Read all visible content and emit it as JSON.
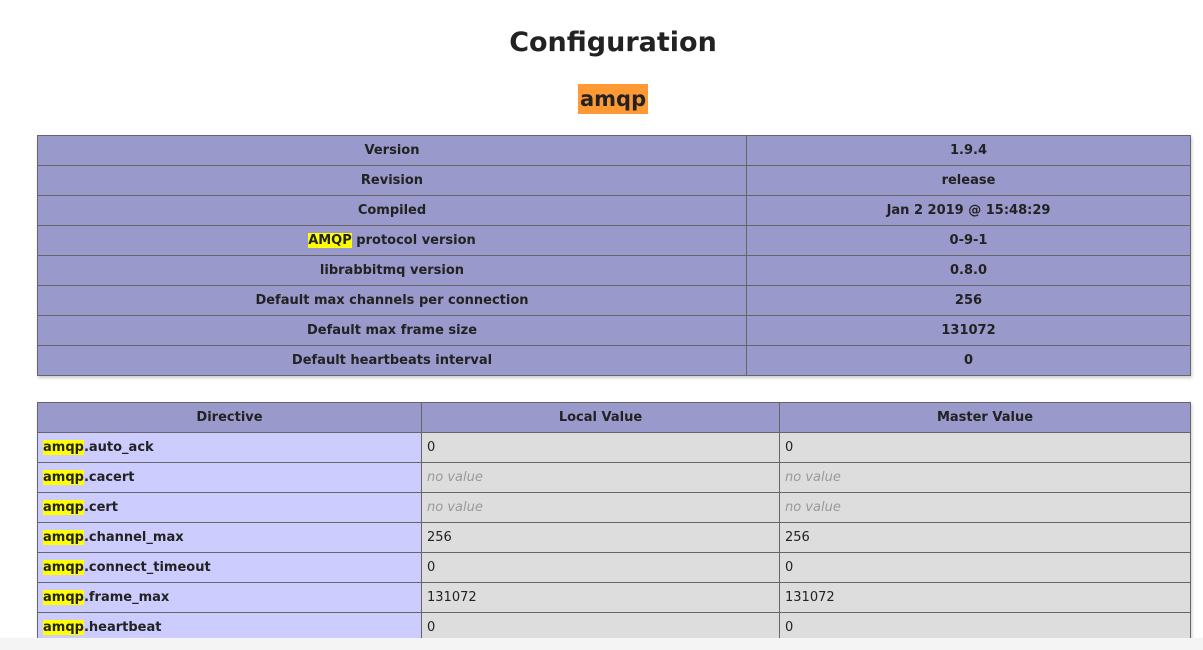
{
  "page": {
    "title": "Configuration",
    "extension": "amqp",
    "highlight_term": "amqp"
  },
  "info": {
    "rows": [
      {
        "label_pre": "",
        "label_hl": "",
        "label_post": "Version",
        "value": "1.9.4"
      },
      {
        "label_pre": "",
        "label_hl": "",
        "label_post": "Revision",
        "value": "release"
      },
      {
        "label_pre": "",
        "label_hl": "",
        "label_post": "Compiled",
        "value": "Jan 2 2019 @ 15:48:29"
      },
      {
        "label_pre": "",
        "label_hl": "AMQP",
        "label_post": " protocol version",
        "value": "0-9-1"
      },
      {
        "label_pre": "",
        "label_hl": "",
        "label_post": "librabbitmq version",
        "value": "0.8.0"
      },
      {
        "label_pre": "",
        "label_hl": "",
        "label_post": "Default max channels per connection",
        "value": "256"
      },
      {
        "label_pre": "",
        "label_hl": "",
        "label_post": "Default max frame size",
        "value": "131072"
      },
      {
        "label_pre": "",
        "label_hl": "",
        "label_post": "Default heartbeats interval",
        "value": "0"
      }
    ]
  },
  "directives": {
    "headers": {
      "directive": "Directive",
      "local": "Local Value",
      "master": "Master Value"
    },
    "rows": [
      {
        "prefix": "amqp",
        "name": ".auto_ack",
        "local": "0",
        "master": "0",
        "no_value": false
      },
      {
        "prefix": "amqp",
        "name": ".cacert",
        "local": "no value",
        "master": "no value",
        "no_value": true
      },
      {
        "prefix": "amqp",
        "name": ".cert",
        "local": "no value",
        "master": "no value",
        "no_value": true
      },
      {
        "prefix": "amqp",
        "name": ".channel_max",
        "local": "256",
        "master": "256",
        "no_value": false
      },
      {
        "prefix": "amqp",
        "name": ".connect_timeout",
        "local": "0",
        "master": "0",
        "no_value": false
      },
      {
        "prefix": "amqp",
        "name": ".frame_max",
        "local": "131072",
        "master": "131072",
        "no_value": false
      },
      {
        "prefix": "amqp",
        "name": ".heartbeat",
        "local": "0",
        "master": "0",
        "no_value": false
      }
    ]
  },
  "colors": {
    "header_bg": "#9999cc",
    "directive_bg": "#ccccff",
    "value_bg": "#dddddd",
    "extension_bg": "#ff9933",
    "highlight_bg": "#ffff00"
  }
}
